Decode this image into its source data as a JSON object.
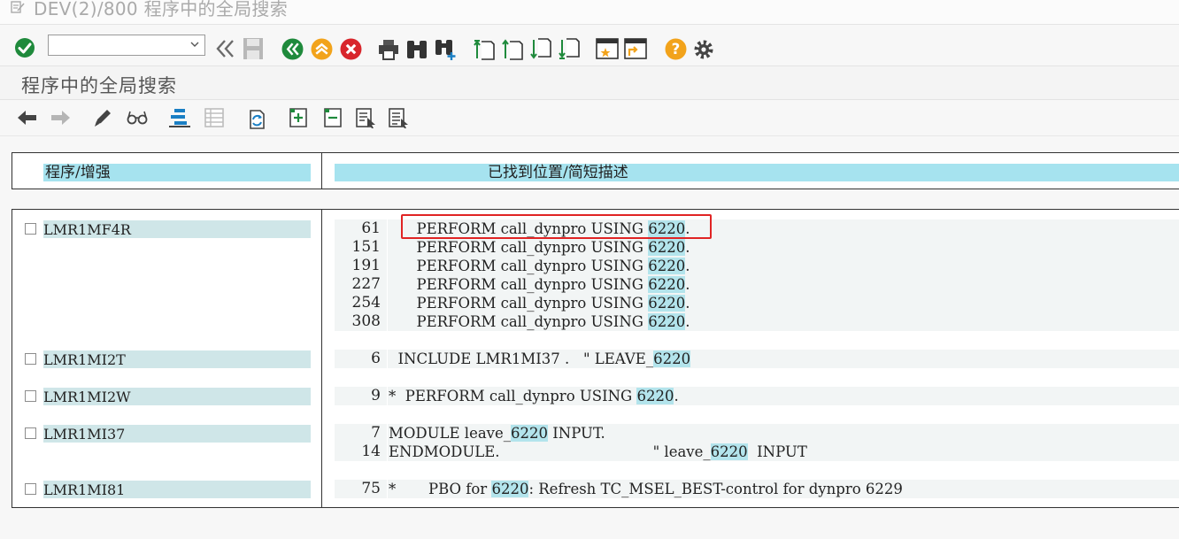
{
  "window": {
    "title": "DEV(2)/800 程序中的全局搜索",
    "title_icon": "document-edit-icon"
  },
  "toolbar1": {
    "command_field": {
      "value": "",
      "placeholder": ""
    },
    "icons": [
      "enter-icon",
      "back-double-icon",
      "save-icon",
      "back-icon",
      "exit-icon",
      "cancel-icon",
      "print-icon",
      "find-icon",
      "find-next-icon",
      "first-page-icon",
      "previous-page-icon",
      "next-page-icon",
      "last-page-icon",
      "create-session-icon",
      "shortcut-icon",
      "help-icon",
      "settings-icon"
    ]
  },
  "page": {
    "heading": "程序中的全局搜索"
  },
  "toolbar2": {
    "icons": [
      "back-arrow-icon",
      "forward-arrow-icon",
      "edit-pencil-icon",
      "display-glasses-icon",
      "hierarchy-icon",
      "table-icon",
      "refresh-icon",
      "expand-icon",
      "collapse-icon",
      "select-icon",
      "deselect-icon"
    ]
  },
  "result_header": {
    "col_program": "程序/增强",
    "col_location": "已找到位置/简短描述"
  },
  "results": [
    {
      "program": "LMR1MF4R",
      "lines": [
        {
          "num": "61",
          "pre": "      PERFORM call_dynpro USING ",
          "hit": "6220",
          "post": "."
        },
        {
          "num": "151",
          "pre": "      PERFORM call_dynpro USING ",
          "hit": "6220",
          "post": "."
        },
        {
          "num": "191",
          "pre": "      PERFORM call_dynpro USING ",
          "hit": "6220",
          "post": "."
        },
        {
          "num": "227",
          "pre": "      PERFORM call_dynpro USING ",
          "hit": "6220",
          "post": "."
        },
        {
          "num": "254",
          "pre": "      PERFORM call_dynpro USING ",
          "hit": "6220",
          "post": "."
        },
        {
          "num": "308",
          "pre": "      PERFORM call_dynpro USING ",
          "hit": "6220",
          "post": "."
        }
      ]
    },
    {
      "program": "LMR1MI2T",
      "lines": [
        {
          "num": "6",
          "pre": "  INCLUDE LMR1MI37 .   \" LEAVE_",
          "hit": "6220",
          "post": ""
        }
      ]
    },
    {
      "program": "LMR1MI2W",
      "lines": [
        {
          "num": "9",
          "pre": "*  PERFORM call_dynpro USING ",
          "hit": "6220",
          "post": "."
        }
      ]
    },
    {
      "program": "LMR1MI37",
      "lines": [
        {
          "num": "7",
          "pre": "MODULE leave_",
          "hit": "6220",
          "post": " INPUT."
        },
        {
          "num": "14",
          "pre": "ENDMODULE.                                 \" leave_",
          "hit": "6220",
          "post": "  INPUT"
        }
      ]
    },
    {
      "program": "LMR1MI81",
      "lines": [
        {
          "num": "75",
          "pre": "*       PBO for ",
          "hit": "6220",
          "post": ": Refresh TC_MSEL_BEST-control for dynpro 6229"
        }
      ]
    }
  ],
  "highlight_color": "#b3e4ec",
  "header_color": "#a6e3ef",
  "annotation_color": "#e02424"
}
